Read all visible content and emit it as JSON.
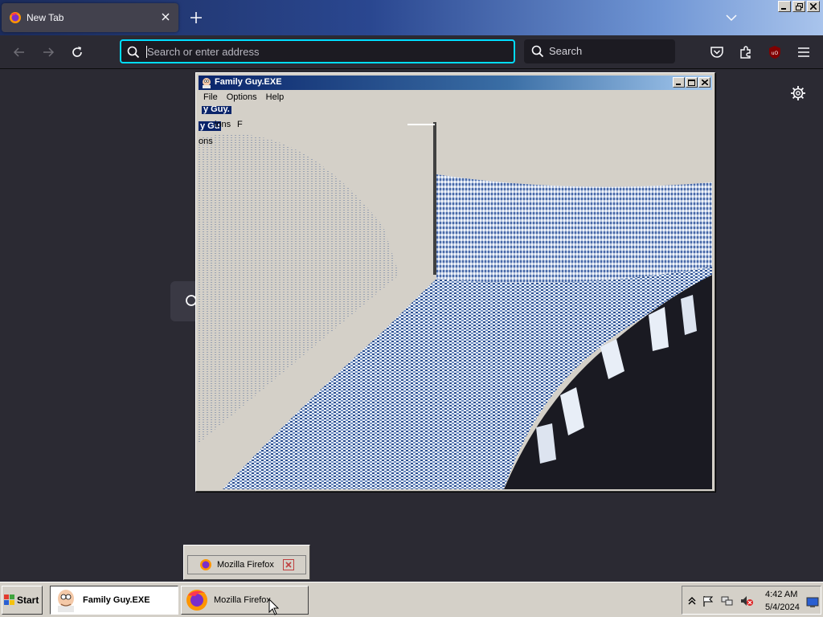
{
  "browser": {
    "tab_title": "New Tab",
    "url_placeholder": "Search or enter address",
    "search_label": "Search",
    "accent_color": "#00ddff",
    "icons": [
      "firefox-icon",
      "tab-close-icon",
      "new-tab-icon",
      "tab-list-icon",
      "back-icon",
      "forward-icon",
      "reload-icon",
      "search-icon",
      "pocket-icon",
      "extensions-icon",
      "ublock-icon",
      "menu-icon",
      "settings-gear-icon"
    ]
  },
  "dialog": {
    "title": "Family Guy.EXE",
    "menus": [
      "File",
      "Options",
      "Help"
    ],
    "ghost_text": [
      "y Guy.",
      "G",
      "y Gu",
      "ions",
      "F",
      "ons"
    ],
    "title_gradient": [
      "#0a246a",
      "#a6caf0"
    ]
  },
  "taskbar": {
    "start_label": "Start",
    "tasks": [
      {
        "label": "Family Guy.EXE",
        "active": true
      },
      {
        "label": "Mozilla Firefox",
        "active": false
      }
    ],
    "popup_label": "Mozilla Firefox",
    "clock_time": "4:42 AM",
    "clock_date": "5/4/2024"
  }
}
